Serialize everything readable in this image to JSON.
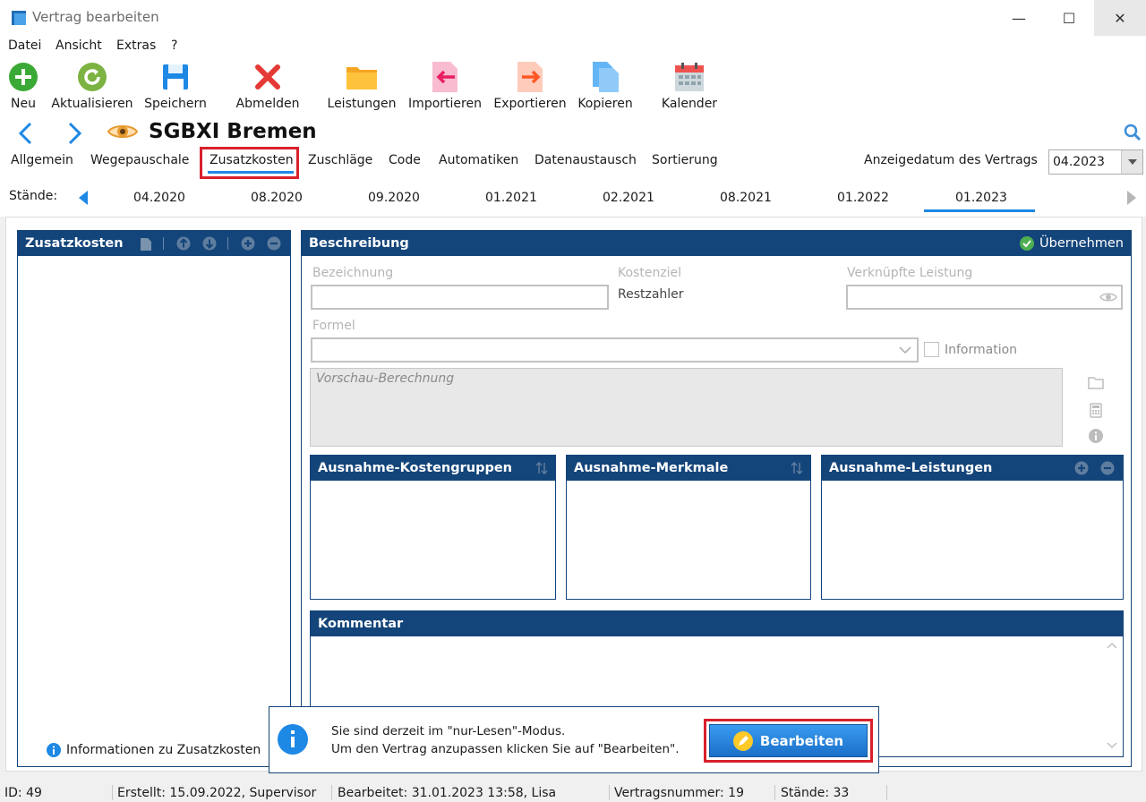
{
  "window": {
    "title": "Vertrag bearbeiten",
    "minimize": "—",
    "maximize": "☐",
    "close": "✕"
  },
  "menu": [
    "Datei",
    "Ansicht",
    "Extras",
    "?"
  ],
  "toolbar": [
    {
      "label": "Neu",
      "icon": "add-icon"
    },
    {
      "label": "Aktualisieren",
      "icon": "refresh-icon"
    },
    {
      "label": "Speichern",
      "icon": "save-icon"
    },
    {
      "label": "Abmelden",
      "icon": "close-red-icon"
    },
    {
      "label": "Leistungen",
      "icon": "folder-icon"
    },
    {
      "label": "Importieren",
      "icon": "import-icon"
    },
    {
      "label": "Exportieren",
      "icon": "export-icon"
    },
    {
      "label": "Kopieren",
      "icon": "copy-icon"
    },
    {
      "label": "Kalender",
      "icon": "calendar-icon"
    }
  ],
  "header": {
    "title": "SGBXI Bremen"
  },
  "tabs": [
    "Allgemein",
    "Wegepauschale",
    "Zusatzkosten",
    "Zuschläge",
    "Code",
    "Automatiken",
    "Datenaustausch",
    "Sortierung"
  ],
  "active_tab": "Zusatzkosten",
  "display_date": {
    "label": "Anzeigedatum des Vertrags",
    "value": "04.2023"
  },
  "versions": {
    "label": "Stände:",
    "items": [
      "04.2020",
      "08.2020",
      "09.2020",
      "01.2021",
      "02.2021",
      "08.2021",
      "01.2022",
      "01.2023"
    ],
    "selected": "01.2023"
  },
  "left_panel": {
    "title": "Zusatzkosten",
    "info_link": "Informationen zu Zusatzkosten"
  },
  "description": {
    "title": "Beschreibung",
    "apply": "Übernehmen",
    "bezeichnung_label": "Bezeichnung",
    "kostenziel_label": "Kostenziel",
    "kostenziel_value": "Restzahler",
    "verknuepfte_label": "Verknüpfte Leistung",
    "formel_label": "Formel",
    "information_label": "Information",
    "preview_placeholder": "Vorschau-Berechnung"
  },
  "sub_panels": [
    "Ausnahme-Kostengruppen",
    "Ausnahme-Merkmale",
    "Ausnahme-Leistungen"
  ],
  "comment": {
    "title": "Kommentar"
  },
  "readonly_notice": {
    "line1": "Sie sind derzeit im \"nur-Lesen\"-Modus.",
    "line2": "Um den Vertrag anzupassen klicken Sie auf \"Bearbeiten\".",
    "button": "Bearbeiten"
  },
  "status": {
    "id": "ID: 49",
    "created": "Erstellt: 15.09.2022, Supervisor",
    "edited": "Bearbeitet: 31.01.2023 13:58, Lisa",
    "contract_no": "Vertragsnummer: 19",
    "versions": "Stände: 33"
  },
  "colors": {
    "panel_header": "#14457a",
    "accent": "#1e88e5",
    "highlight_red": "#d9202c"
  }
}
